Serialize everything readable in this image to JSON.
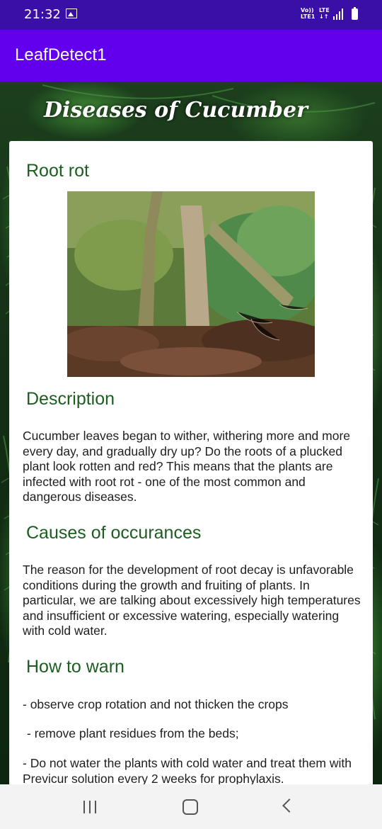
{
  "status_bar": {
    "time": "21:32",
    "network_top": "Vo))",
    "network_bottom": "LTE1",
    "lte_top": "LTE",
    "lte_bottom": "↓↑"
  },
  "app_bar": {
    "title": "LeafDetect1"
  },
  "page": {
    "heading": "Diseases of Cucumber"
  },
  "card": {
    "disease_name": "Root rot",
    "description_title": "Description",
    "description_text": "Cucumber leaves began to wither, withering more and more every day, and gradually dry up? Do the roots of a plucked plant look rotten and red? This means that the plants are infected with root rot - one of the most common and dangerous diseases.",
    "causes_title": "Causes of occurances",
    "causes_text": "The reason for the development of root decay is unfavorable conditions during the growth and fruiting of plants. In particular, we are talking about excessively high temperatures and insufficient or excessive watering, especially watering with cold water.",
    "prevention_title": "How to warn",
    "prevention_items": [
      "- observe crop rotation and not thicken the crops",
      "- remove plant residues from the beds;",
      "- Do not water the plants with cold water and treat them with Previcur solution every 2 weeks for prophylaxis."
    ]
  },
  "icons": {
    "gallery": "image-icon",
    "signal": "signal-icon",
    "battery": "battery-icon",
    "recents": "recents-icon",
    "home": "home-icon",
    "back": "back-icon"
  },
  "colors": {
    "status_bar": "#3a0fa8",
    "app_bar": "#6200ee",
    "section_title": "#1b5e20",
    "card": "#ffffff"
  }
}
